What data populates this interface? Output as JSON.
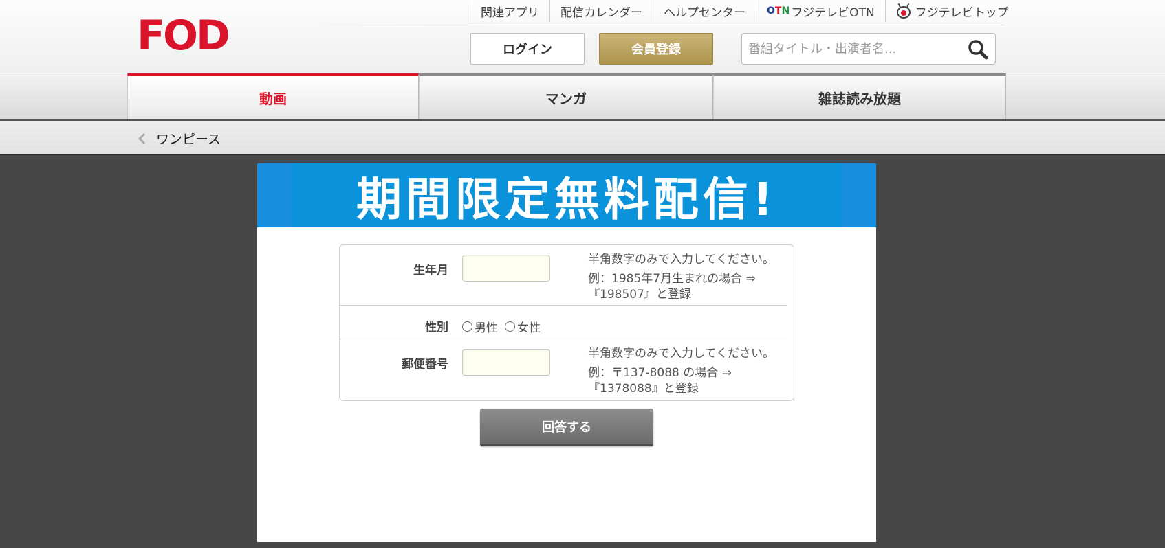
{
  "header": {
    "logo_text": "FOD",
    "util_links": [
      "関連アプリ",
      "配信カレンダー",
      "ヘルプセンター"
    ],
    "otn_logo": {
      "o": "O",
      "t": "T",
      "n": "N"
    },
    "otn_label": "フジテレビOTN",
    "fuji_top_label": "フジテレビトップ",
    "login_label": "ログイン",
    "register_label": "会員登録",
    "search_placeholder": "番組タイトル・出演者名..."
  },
  "tabs": [
    {
      "label": "動画",
      "active": true
    },
    {
      "label": "マンガ",
      "active": false
    },
    {
      "label": "雑誌読み放題",
      "active": false
    }
  ],
  "breadcrumb": {
    "label": "ワンピース"
  },
  "banner": {
    "text": "期間限定無料配信!"
  },
  "form": {
    "birth": {
      "label": "生年月",
      "value": "",
      "hint1": "半角数字のみで入力してください。",
      "hint2": "例：1985年7月生まれの場合 ⇒",
      "hint3": "『198507』と登録"
    },
    "gender": {
      "label": "性別",
      "options": [
        "男性",
        "女性"
      ]
    },
    "postal": {
      "label": "郵便番号",
      "value": "",
      "hint1": "半角数字のみで入力してください。",
      "hint2": "例：〒137-8088 の場合 ⇒",
      "hint3": "『1378088』と登録"
    },
    "submit_label": "回答する"
  },
  "colors": {
    "brand_red": "#d9142b",
    "gold": "#b89c55",
    "banner_blue": "#0a92da",
    "page_dark": "#474747"
  }
}
